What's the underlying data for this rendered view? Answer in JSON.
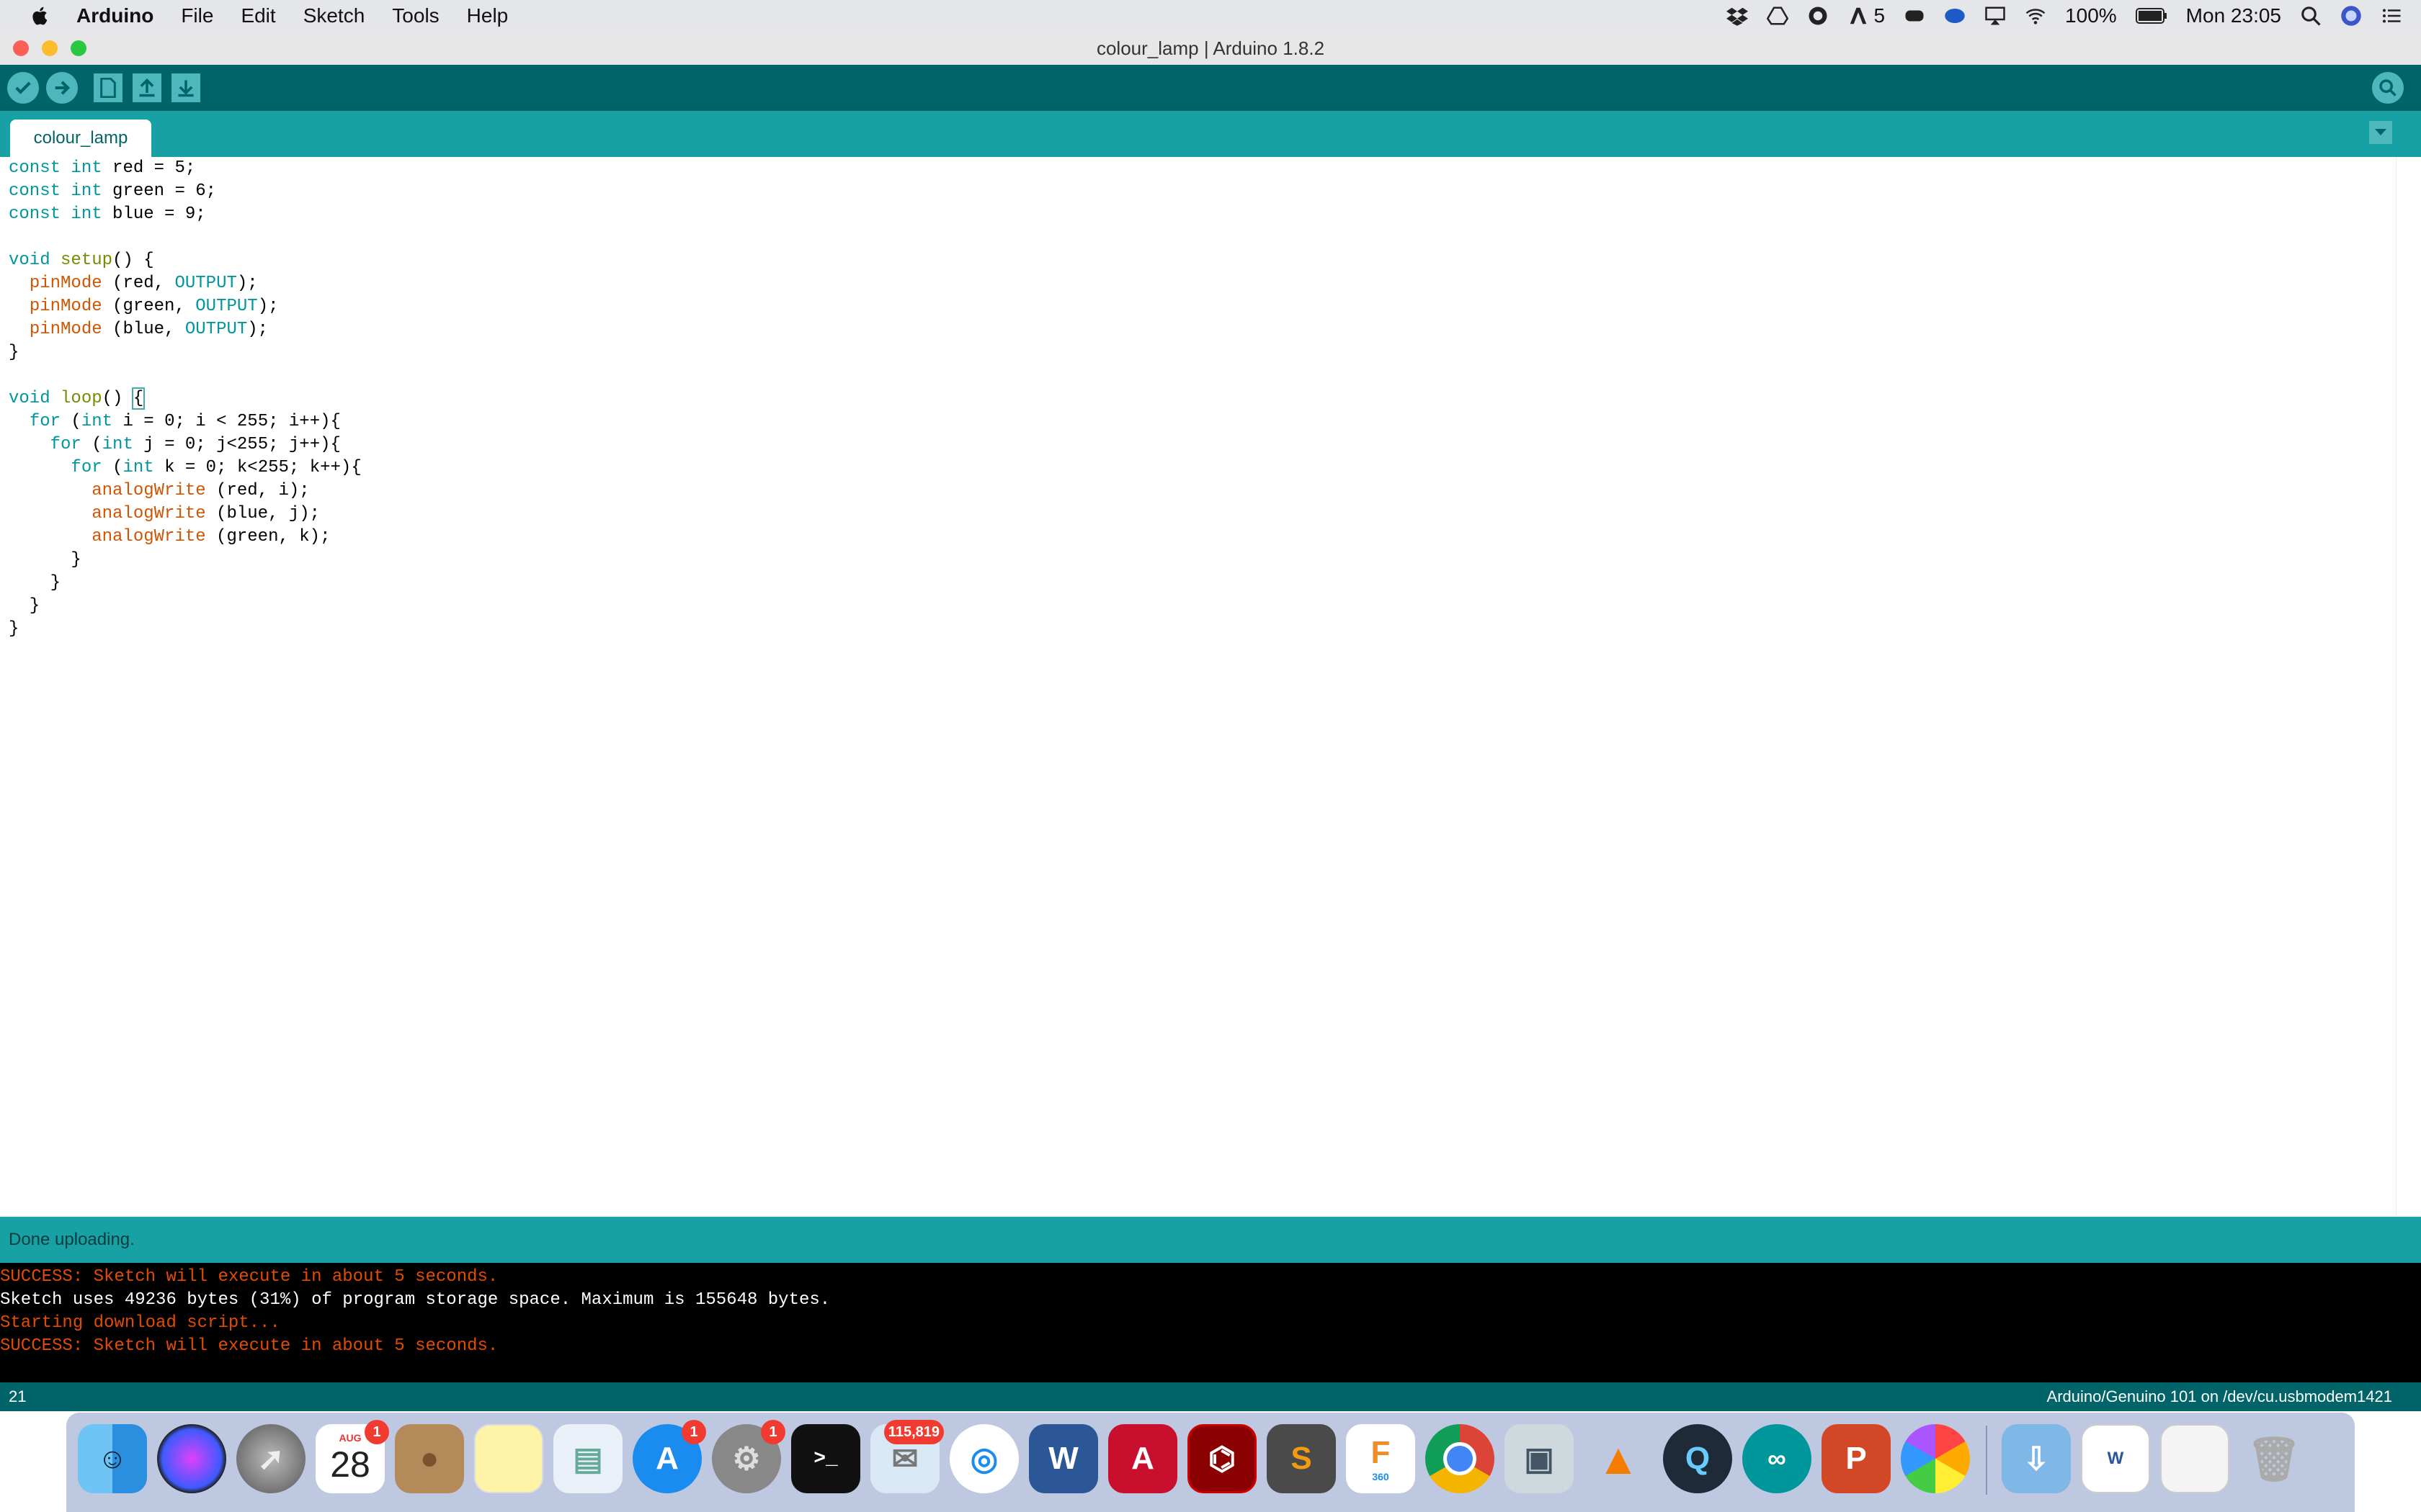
{
  "menubar": {
    "app_name": "Arduino",
    "items": [
      "File",
      "Edit",
      "Sketch",
      "Tools",
      "Help"
    ],
    "notif_count": "5",
    "battery": "100%",
    "clock": "Mon 23:05"
  },
  "window": {
    "title": "colour_lamp | Arduino 1.8.2"
  },
  "toolbar": {
    "icons": [
      "verify-icon",
      "upload-icon",
      "new-icon",
      "open-icon",
      "save-icon",
      "serial-monitor-icon"
    ]
  },
  "tabs": [
    {
      "label": "colour_lamp"
    }
  ],
  "editor": {
    "lines": [
      "const int red = 5;",
      "const int green = 6;",
      "const int blue = 9;",
      "",
      "void setup() {",
      "  pinMode (red, OUTPUT);",
      "  pinMode (green, OUTPUT);",
      "  pinMode (blue, OUTPUT);",
      "}",
      "",
      "void loop() {",
      "  for (int i = 0; i < 255; i++){",
      "    for (int j = 0; j<255; j++){",
      "      for (int k = 0; k<255; k++){",
      "        analogWrite (red, i);",
      "        analogWrite (blue, j);",
      "        analogWrite (green, k);",
      "      }",
      "    }",
      "  }",
      "}"
    ]
  },
  "status": {
    "message": "Done uploading."
  },
  "console": {
    "lines": [
      {
        "text": "SUCCESS: Sketch will execute in about 5 seconds.",
        "type": "err"
      },
      {
        "text": "Sketch uses 49236 bytes (31%) of program storage space. Maximum is 155648 bytes.",
        "type": "ok"
      },
      {
        "text": "Starting download script...",
        "type": "err"
      },
      {
        "text": "SUCCESS: Sketch will execute in about 5 seconds.",
        "type": "err"
      }
    ]
  },
  "bottombar": {
    "line_number": "21",
    "board": "Arduino/Genuino 101 on /dev/cu.usbmodem1421"
  },
  "dock": {
    "calendar_month": "AUG",
    "calendar_day": "28",
    "calendar_badge": "1",
    "appstore_badge": "1",
    "prefs_badge": "1",
    "mail_badge": "115,819",
    "fusion_label": "360",
    "apps": [
      "Finder",
      "Siri",
      "Launchpad",
      "Calendar",
      "Contacts",
      "Notes",
      "Preview",
      "App Store",
      "System Preferences",
      "Terminal",
      "Mail",
      "Safari",
      "Word",
      "AutoCAD",
      "Acrobat",
      "Sublime Text",
      "Fusion 360",
      "Chrome",
      "Image Capture",
      "VLC",
      "QuickTime",
      "Arduino",
      "PowerPoint",
      "Photos",
      "Downloads",
      "Document",
      "Screenshots",
      "Trash"
    ]
  },
  "colors": {
    "toolbar": "#006468",
    "tabbar": "#17a1a5",
    "keyword": "#00979c",
    "function": "#d35400",
    "console_error": "#e34c00"
  }
}
